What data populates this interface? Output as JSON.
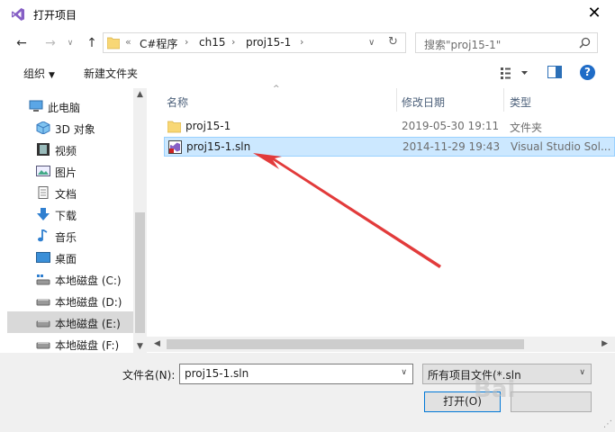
{
  "dialog": {
    "title": "打开项目",
    "close_glyph": "✕"
  },
  "nav": {
    "back_glyph": "←",
    "forward_glyph": "→",
    "dropdown_glyph": "∨",
    "up_glyph": "↑"
  },
  "address": {
    "chevron": "«",
    "crumbs": [
      "C#程序",
      "ch15",
      "proj15-1"
    ],
    "separator": "›",
    "dropdown_glyph": "∨",
    "refresh_glyph": "↻"
  },
  "search": {
    "placeholder": "搜索\"proj15-1\""
  },
  "toolbar": {
    "organize_label": "组织",
    "organize_arrow": "▼",
    "new_folder_label": "新建文件夹",
    "help_label": "?"
  },
  "sidebar": {
    "items": [
      {
        "label": "此电脑",
        "icon": "computer-icon"
      },
      {
        "label": "3D 对象",
        "icon": "cube-icon"
      },
      {
        "label": "视频",
        "icon": "film-icon"
      },
      {
        "label": "图片",
        "icon": "picture-icon"
      },
      {
        "label": "文档",
        "icon": "document-icon"
      },
      {
        "label": "下载",
        "icon": "download-icon"
      },
      {
        "label": "音乐",
        "icon": "music-icon"
      },
      {
        "label": "桌面",
        "icon": "desktop-icon"
      },
      {
        "label": "本地磁盘 (C:)",
        "icon": "drive-icon"
      },
      {
        "label": "本地磁盘 (D:)",
        "icon": "drive-icon"
      },
      {
        "label": "本地磁盘 (E:)",
        "icon": "drive-icon"
      },
      {
        "label": "本地磁盘 (F:)",
        "icon": "drive-icon"
      }
    ],
    "selected": "本地磁盘 (E:)",
    "scroll_up": "▲",
    "scroll_down": "▼"
  },
  "files": {
    "columns": [
      "名称",
      "修改日期",
      "类型"
    ],
    "sort_glyph": "^",
    "rows": [
      {
        "name": "proj15-1",
        "date": "2019-05-30 19:11",
        "type": "文件夹",
        "icon": "folder-icon"
      },
      {
        "name": "proj15-1.sln",
        "date": "2014-11-29 19:43",
        "type": "Visual Studio Sol...",
        "icon": "visual-studio-solution-icon"
      }
    ],
    "selected": "proj15-1.sln",
    "scroll_left": "◀",
    "scroll_right": "▶"
  },
  "footer": {
    "filename_label": "文件名(N):",
    "filename_value": "proj15-1.sln",
    "filename_drop": "∨",
    "filetype_value": "所有项目文件(*.sln",
    "filetype_drop": "∨",
    "open_label": "打开(O)",
    "grip_glyph": "⋰"
  },
  "annotation": {
    "arrow_color": "#e23b3b"
  },
  "watermark": {
    "text": "Bai"
  },
  "colors": {
    "selection": "#cce8ff",
    "selection_border": "#99d1ff",
    "sidebar_selected": "#d9d9d9",
    "help_blue": "#1f6cc7",
    "vs_purple": "#865fc5",
    "folder_yellow": "#f8d775"
  }
}
